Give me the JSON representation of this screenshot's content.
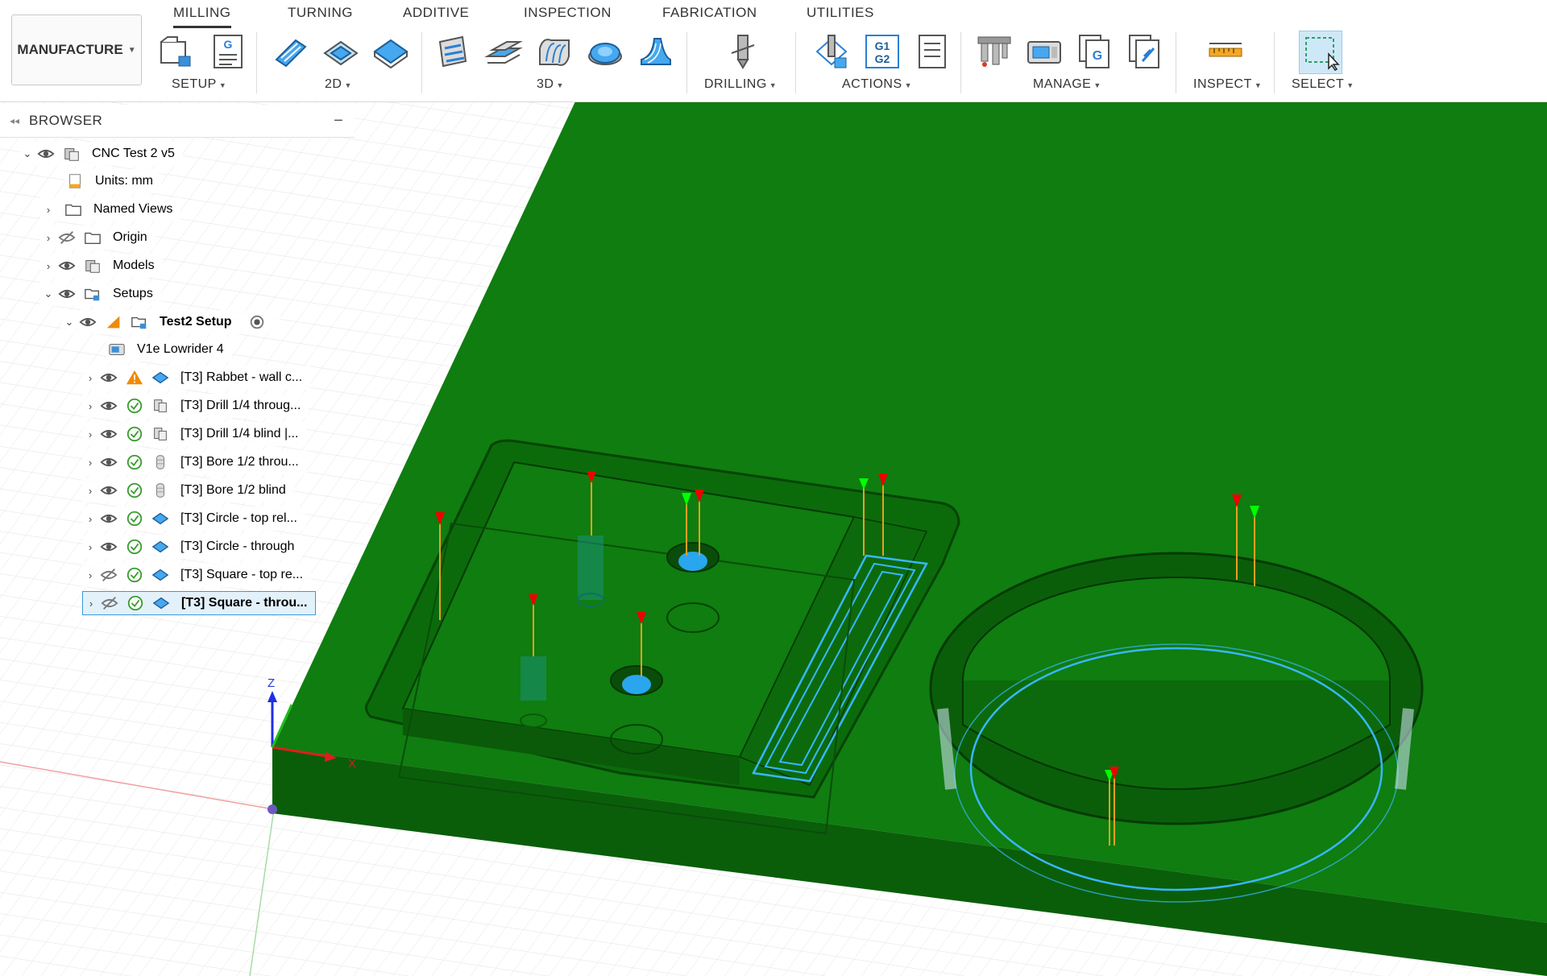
{
  "workspace": {
    "label": "MANUFACTURE"
  },
  "tabs": [
    {
      "label": "MILLING",
      "active": true
    },
    {
      "label": "TURNING"
    },
    {
      "label": "ADDITIVE"
    },
    {
      "label": "INSPECTION"
    },
    {
      "label": "FABRICATION"
    },
    {
      "label": "UTILITIES"
    }
  ],
  "groups": {
    "setup": "SETUP",
    "twod": "2D",
    "threed": "3D",
    "drilling": "DRILLING",
    "actions": "ACTIONS",
    "manage": "MANAGE",
    "inspect": "INSPECT",
    "select": "SELECT"
  },
  "tool_glyphs": {
    "gcode": "G",
    "g1": "G1",
    "g2": "G2"
  },
  "browser": {
    "title": "BROWSER",
    "root": "CNC Test 2 v5",
    "units": "Units: mm",
    "named_views": "Named Views",
    "origin": "Origin",
    "models": "Models",
    "setups": "Setups",
    "setup_name": "Test2 Setup",
    "machine": "V1e Lowrider 4",
    "operations": [
      {
        "label": "[T3] Rabbet - wall c...",
        "status": "warning",
        "icon": "pocket-icon",
        "visible": true
      },
      {
        "label": "[T3] Drill 1/4 throug...",
        "status": "ok",
        "icon": "drill-icon",
        "visible": true
      },
      {
        "label": "[T3] Drill 1/4 blind |...",
        "status": "ok",
        "icon": "drill-icon",
        "visible": true
      },
      {
        "label": "[T3] Bore 1/2 throu...",
        "status": "ok",
        "icon": "bore-icon",
        "visible": true
      },
      {
        "label": "[T3] Bore 1/2 blind",
        "status": "ok",
        "icon": "bore-icon",
        "visible": true
      },
      {
        "label": "[T3] Circle - top rel...",
        "status": "ok",
        "icon": "pocket-icon",
        "visible": true
      },
      {
        "label": "[T3] Circle - through",
        "status": "ok",
        "icon": "pocket-icon",
        "visible": true
      },
      {
        "label": "[T3] Square - top re...",
        "status": "ok",
        "icon": "pocket-icon",
        "visible": false
      },
      {
        "label": "[T3] Square - throu...",
        "status": "ok",
        "icon": "pocket-icon",
        "visible": false,
        "selected": true
      }
    ]
  },
  "axis": {
    "z": "Z",
    "x": "X"
  },
  "colors": {
    "stock": "#0f7a0f",
    "stock_dark": "#0a5e0a",
    "toolpath": "#39b6ff",
    "accent": "#3a9ad9"
  }
}
